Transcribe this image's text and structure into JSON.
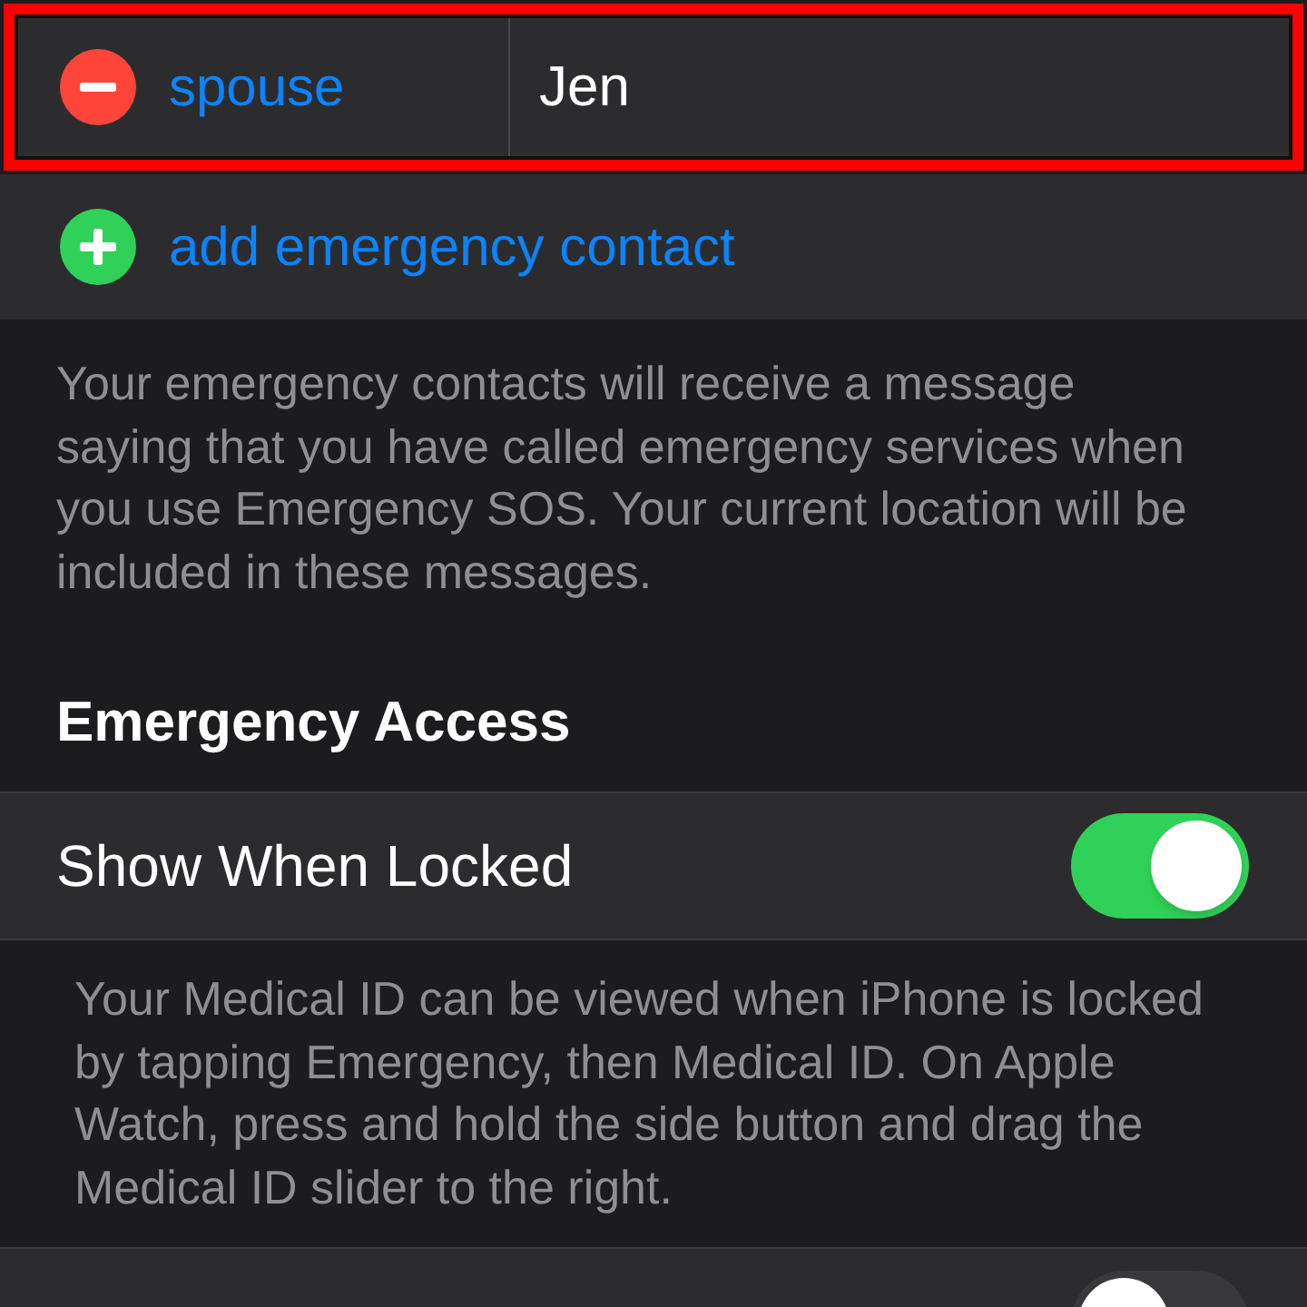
{
  "contacts": [
    {
      "relationship": "spouse",
      "name": "Jen",
      "highlighted": true
    }
  ],
  "add_contact": {
    "label": "add emergency contact"
  },
  "contacts_footer": "Your emergency contacts will receive a message saying that you have called emergency services when you use Emergency SOS. Your current location will be included in these messages.",
  "emergency_access": {
    "title": "Emergency Access",
    "toggle_row": {
      "label": "Show When Locked",
      "on": true
    },
    "footer": "Your Medical ID can be viewed when iPhone is locked by tapping Emergency, then Medical ID. On Apple Watch, press and hold the side button and drag the Medical ID slider to the right."
  },
  "partial_row": {
    "on": false
  }
}
